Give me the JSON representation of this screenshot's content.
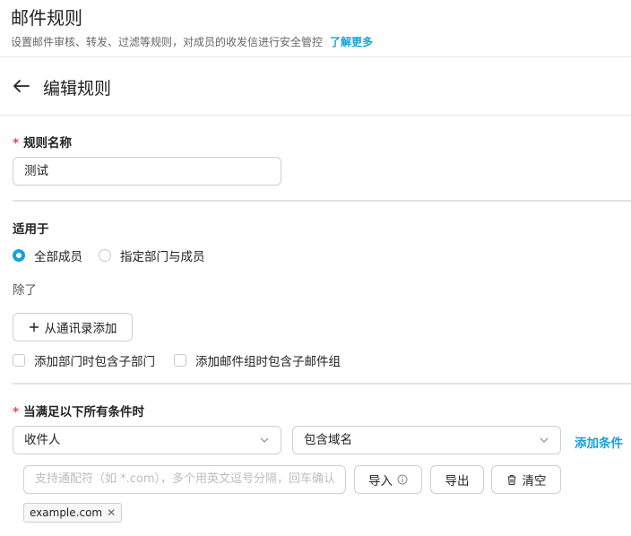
{
  "header": {
    "title": "邮件规则",
    "subtitle": "设置邮件审核、转发、过滤等规则，对成员的收发信进行安全管控",
    "learn_more": "了解更多"
  },
  "editor": {
    "title": "编辑规则"
  },
  "rule_name": {
    "required_mark": "*",
    "label": "规则名称",
    "value": "测试"
  },
  "applies_to": {
    "label": "适用于",
    "options": [
      {
        "label": "全部成员",
        "selected": true
      },
      {
        "label": "指定部门与成员",
        "selected": false
      }
    ],
    "except_label": "除了",
    "add_from_contacts": "从通讯录添加",
    "include_sub_depts": "添加部门时包含子部门",
    "include_sub_groups": "添加邮件组时包含子邮件组"
  },
  "conditions": {
    "required_mark": "*",
    "label": "当满足以下所有条件时",
    "field_select": "收件人",
    "operator_select": "包含域名",
    "add_condition": "添加条件",
    "input_placeholder": "支持通配符（如 *.com），多个用英文逗号分隔，回车确认",
    "import_label": "导入",
    "export_label": "导出",
    "clear_label": "清空",
    "tags": [
      "example.com"
    ]
  },
  "colors": {
    "accent": "#1aa1d8",
    "required": "#e5484d"
  }
}
